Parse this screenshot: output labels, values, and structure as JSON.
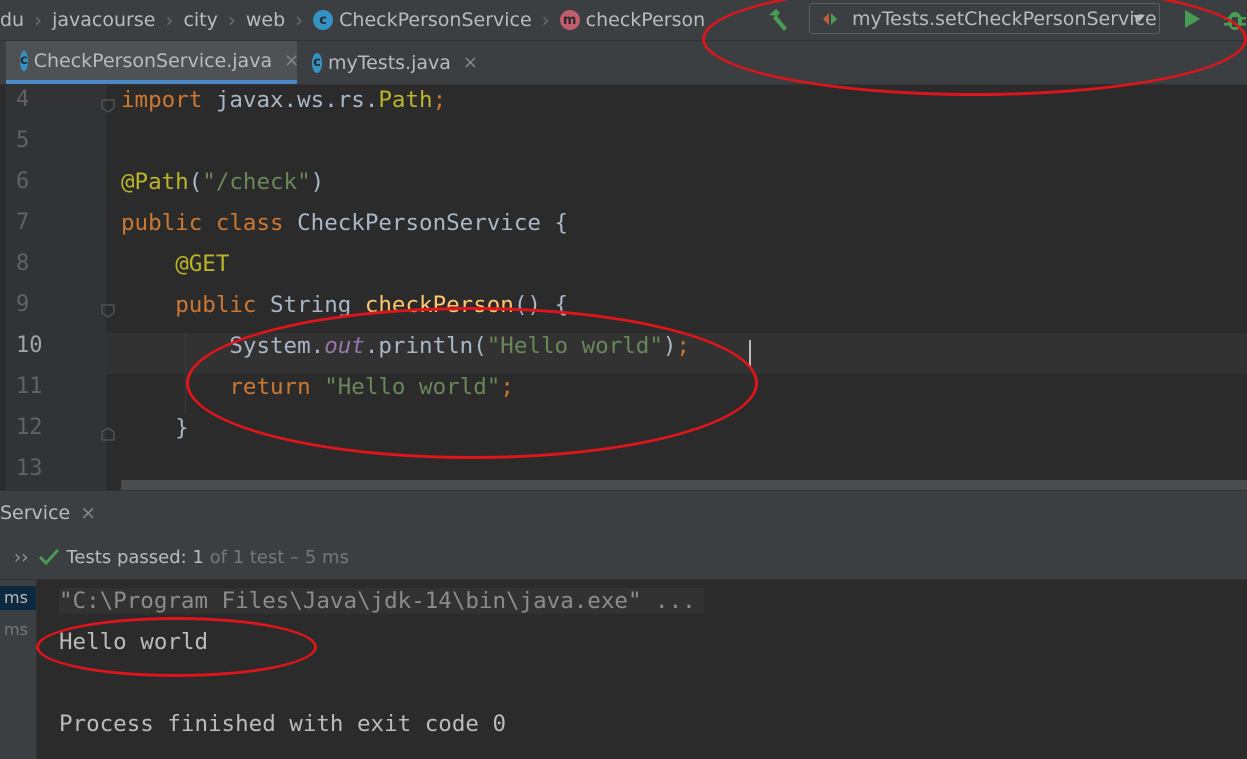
{
  "breadcrumbs": [
    "du",
    "javacourse",
    "city",
    "web",
    "CheckPersonService",
    "checkPerson"
  ],
  "run_config": {
    "label": "myTests.setCheckPersonService"
  },
  "tabs": [
    {
      "label": "CheckPersonService.java",
      "active": true
    },
    {
      "label": "myTests.java",
      "active": false
    }
  ],
  "editor": {
    "current_line": 10,
    "lines": [
      {
        "num": "4",
        "text": "import javax.ws.rs.Path;"
      },
      {
        "num": "5",
        "text": ""
      },
      {
        "num": "6",
        "text": "@Path(\"/check\")"
      },
      {
        "num": "7",
        "text": "public class CheckPersonService {"
      },
      {
        "num": "8",
        "text": "    @GET"
      },
      {
        "num": "9",
        "text": "    public String checkPerson() {"
      },
      {
        "num": "10",
        "text": "        System.out.println(\"Hello world\");"
      },
      {
        "num": "11",
        "text": "        return \"Hello world\";"
      },
      {
        "num": "12",
        "text": "    }"
      },
      {
        "num": "13",
        "text": ""
      }
    ]
  },
  "run_panel": {
    "tab_label": "Service",
    "status": {
      "prefix": "Tests passed: ",
      "count": "1",
      "suffix": " of 1 test – 5 ms"
    },
    "left_times": [
      "ms",
      "ms"
    ],
    "console": {
      "command": "\"C:\\Program Files\\Java\\jdk-14\\bin\\java.exe\" ...",
      "output": "Hello world",
      "exit": "Process finished with exit code 0"
    }
  },
  "colors": {
    "keyword": "#cc7832",
    "annotation": "#bbb529",
    "string": "#6a8759",
    "field": "#9876aa",
    "highlight_oval": "#e0141b",
    "pass_green": "#499c54"
  },
  "icons": [
    "build-hammer-icon",
    "run-icon",
    "debug-icon",
    "class-icon",
    "method-icon",
    "check-icon"
  ]
}
